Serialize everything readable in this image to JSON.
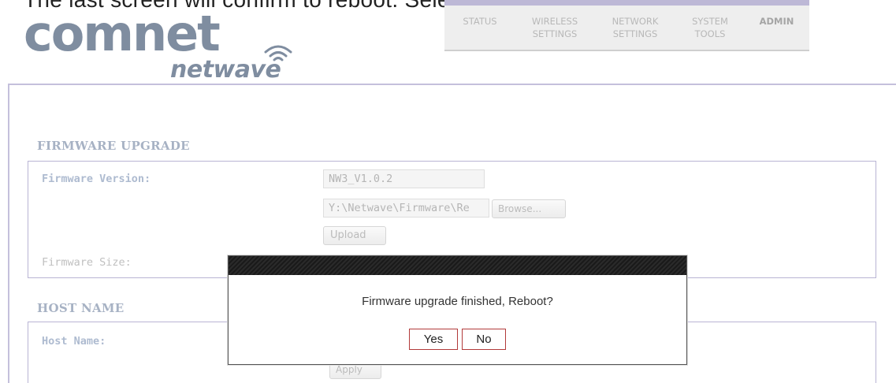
{
  "caption": "The last screen will confirm to reboot. Select Yes.",
  "logo": {
    "brand": "comnet",
    "product": "netwave",
    "wifi_icon": "wifi-icon"
  },
  "nav": {
    "items": [
      {
        "label": "STATUS"
      },
      {
        "label": "WIRELESS\nSETTINGS"
      },
      {
        "label": "NETWORK\nSETTINGS"
      },
      {
        "label": "SYSTEM\nTOOLS"
      },
      {
        "label": "ADMIN",
        "active": true
      }
    ]
  },
  "firmware": {
    "title": "FIRMWARE UPGRADE",
    "version_label": "Firmware Version:",
    "version_value": "NW3_V1.0.2",
    "file_path": "Y:\\Netwave\\Firmware\\Re",
    "browse_label": "Browse...",
    "upload_label": "Upload",
    "size_label": "Firmware Size:"
  },
  "host": {
    "title": "HOST NAME",
    "name_label": "Host Name:",
    "apply_label": "Apply"
  },
  "dialog": {
    "message": "Firmware upgrade finished, Reboot?",
    "yes_label": "Yes",
    "no_label": "No"
  },
  "colors": {
    "accent_border": "#b9b4d4",
    "dialog_button_border": "#b23a3a",
    "logo": "#7f8da0"
  }
}
